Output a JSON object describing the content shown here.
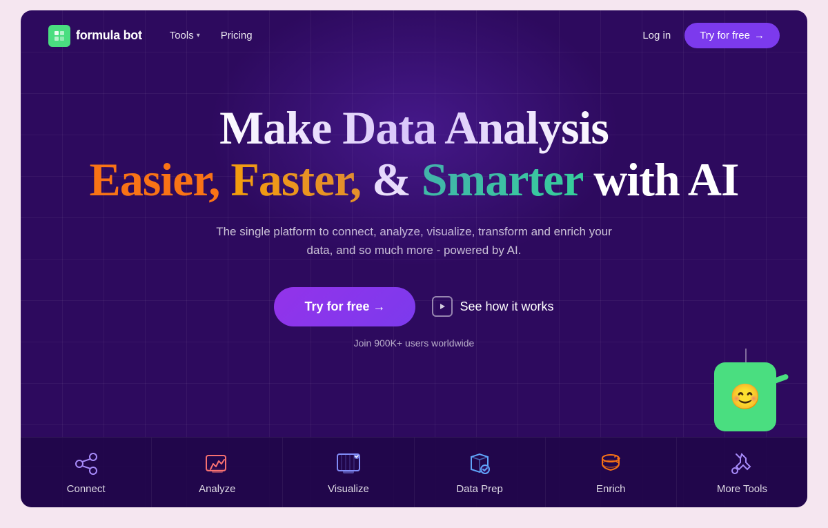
{
  "nav": {
    "logo_text": "formula bot",
    "tools_label": "Tools",
    "pricing_label": "Pricing",
    "login_label": "Log in",
    "try_nav_label": "Try for free",
    "try_nav_arrow": "→"
  },
  "hero": {
    "title_line1": "Make Data Analysis",
    "word_easier": "Easier,",
    "word_faster": "Faster,",
    "word_and": "&",
    "word_smarter": "Smarter",
    "word_with_ai": "with AI",
    "subtitle": "The single platform to connect, analyze, visualize, transform and enrich your data, and so much more - powered by AI.",
    "try_free_label": "Try for free →",
    "see_how_label": "See how it works",
    "join_text": "Join 900K+ users worldwide"
  },
  "bottom_nav": {
    "items": [
      {
        "id": "connect",
        "label": "Connect"
      },
      {
        "id": "analyze",
        "label": "Analyze"
      },
      {
        "id": "visualize",
        "label": "Visualize"
      },
      {
        "id": "data-prep",
        "label": "Data Prep"
      },
      {
        "id": "enrich",
        "label": "Enrich"
      },
      {
        "id": "more-tools",
        "label": "More Tools"
      }
    ]
  },
  "colors": {
    "bg": "#2d0a5e",
    "accent_purple": "#7c3aed",
    "green": "#4ade80",
    "orange": "#f97316",
    "amber": "#f59e0b",
    "teal": "#34d399"
  }
}
